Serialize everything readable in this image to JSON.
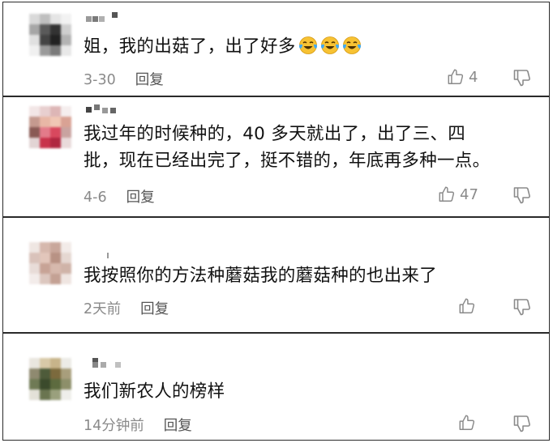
{
  "icons": {
    "like": "thumbs-up-outline-icon",
    "dislike": "thumbs-down-outline-icon",
    "emoji": "tears-of-joy-emoji"
  },
  "colors": {
    "text": "#111111",
    "meta": "#8a8a8a",
    "reply": "#555555",
    "border": "#2a2a2a",
    "emoji_face": "#f7c233",
    "emoji_tears": "#3fa9f5"
  },
  "comments": [
    {
      "text_lines": [
        "姐，我的出菇了，出了好多"
      ],
      "emoji_count": 3,
      "time": "3-30",
      "reply_label": "回复",
      "like_count": "4"
    },
    {
      "text_lines": [
        "我过年的时候种的，40 多天就出了，出了三、四",
        "批，现在已经出完了，挺不错的，年底再多种一点。"
      ],
      "time": "4-6",
      "reply_label": "回复",
      "like_count": "47"
    },
    {
      "text_lines": [
        "我按照你的方法种蘑菇我的蘑菇种的也出来了"
      ],
      "time": "2天前",
      "reply_label": "回复",
      "like_count": ""
    },
    {
      "text_lines": [
        "我们新农人的榜样"
      ],
      "time": "14分钟前",
      "reply_label": "回复",
      "like_count": ""
    }
  ]
}
